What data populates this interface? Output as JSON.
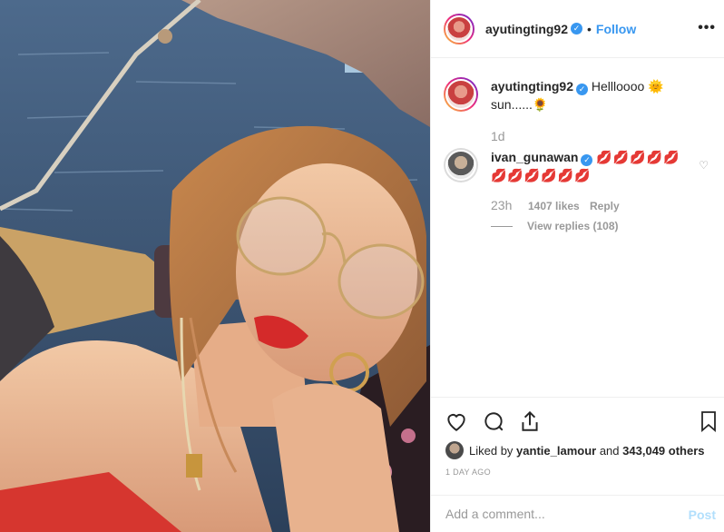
{
  "post": {
    "author": "ayutingting92",
    "follow_label": "Follow",
    "dot": "•",
    "more_label": "•••"
  },
  "caption": {
    "author": "ayutingting92",
    "text": "Hellloooo 🌞 sun......🌻",
    "age": "1d"
  },
  "comment": {
    "author": "ivan_gunawan",
    "text": "💋💋💋💋💋💋💋💋💋💋💋",
    "age": "23h",
    "likes": "1407 likes",
    "reply_label": "Reply",
    "view_replies": "View replies (108)"
  },
  "icons": {
    "like": "heart-icon",
    "comment": "comment-bubble-icon",
    "share": "share-icon",
    "save": "bookmark-icon",
    "verified": "verified-badge-icon"
  },
  "likes_summary": {
    "prefix": "Liked by",
    "first_user": "yantie_lamour",
    "conjunction": "and",
    "others": "343,049 others"
  },
  "timestamp": "1 DAY AGO",
  "add_comment": {
    "placeholder": "Add a comment...",
    "post_label": "Post"
  },
  "colors": {
    "link_blue": "#3897f0",
    "post_disabled": "#b2dffc",
    "muted": "#999999"
  }
}
